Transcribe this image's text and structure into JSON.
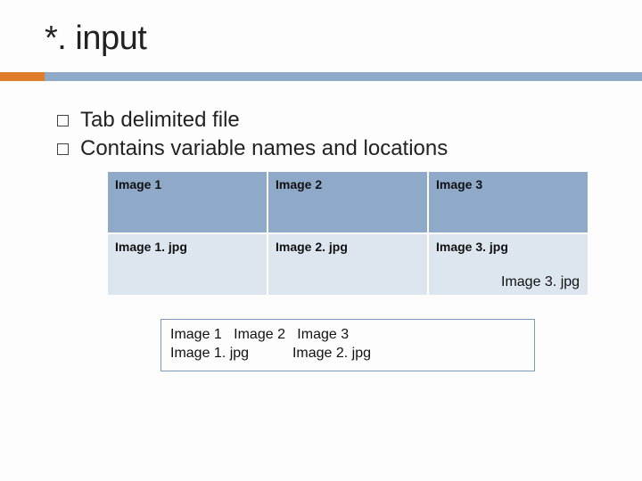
{
  "title": "*. input",
  "bullets": [
    "Tab delimited file",
    "Contains variable names and locations"
  ],
  "table": {
    "headers": [
      "Image 1",
      "Image 2",
      "Image 3"
    ],
    "rows": [
      [
        "Image 1. jpg",
        "Image 2. jpg",
        "Image 3. jpg"
      ]
    ]
  },
  "raw": {
    "line1": "Image 1   Image 2   Image 3",
    "line2": "Image 1. jpg           Image 2. jpg",
    "trailing": "Image 3. jpg"
  }
}
